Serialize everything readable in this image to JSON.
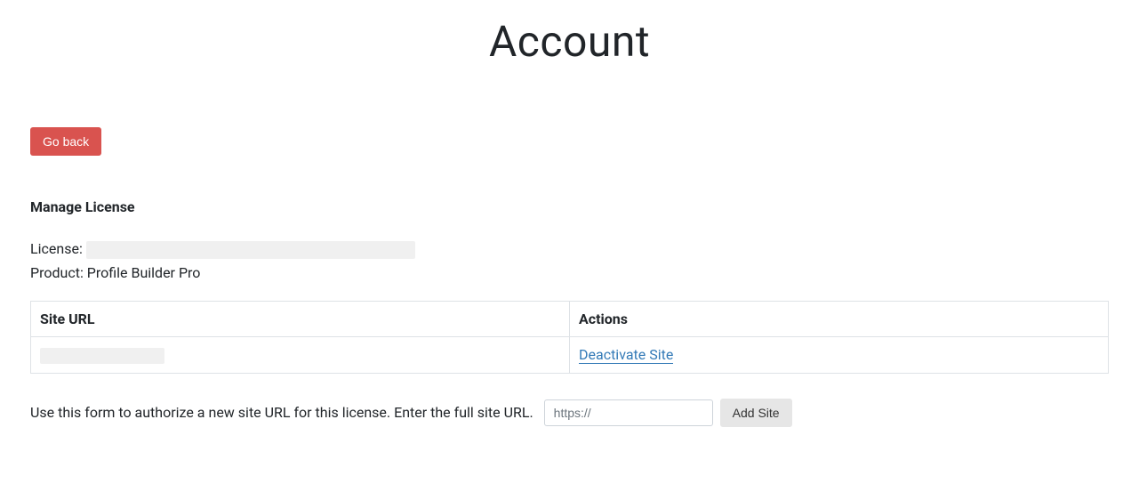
{
  "page_title": "Account",
  "go_back_label": "Go back",
  "section_heading": "Manage License",
  "license_label": "License:",
  "license_value": "",
  "product_label": "Product:",
  "product_value": "Profile Builder Pro",
  "table": {
    "headers": {
      "site_url": "Site URL",
      "actions": "Actions"
    },
    "rows": [
      {
        "site_url": "",
        "action_label": "Deactivate Site"
      }
    ]
  },
  "form": {
    "help_text": "Use this form to authorize a new site URL for this license. Enter the full site URL.",
    "placeholder": "https://",
    "add_label": "Add Site"
  }
}
